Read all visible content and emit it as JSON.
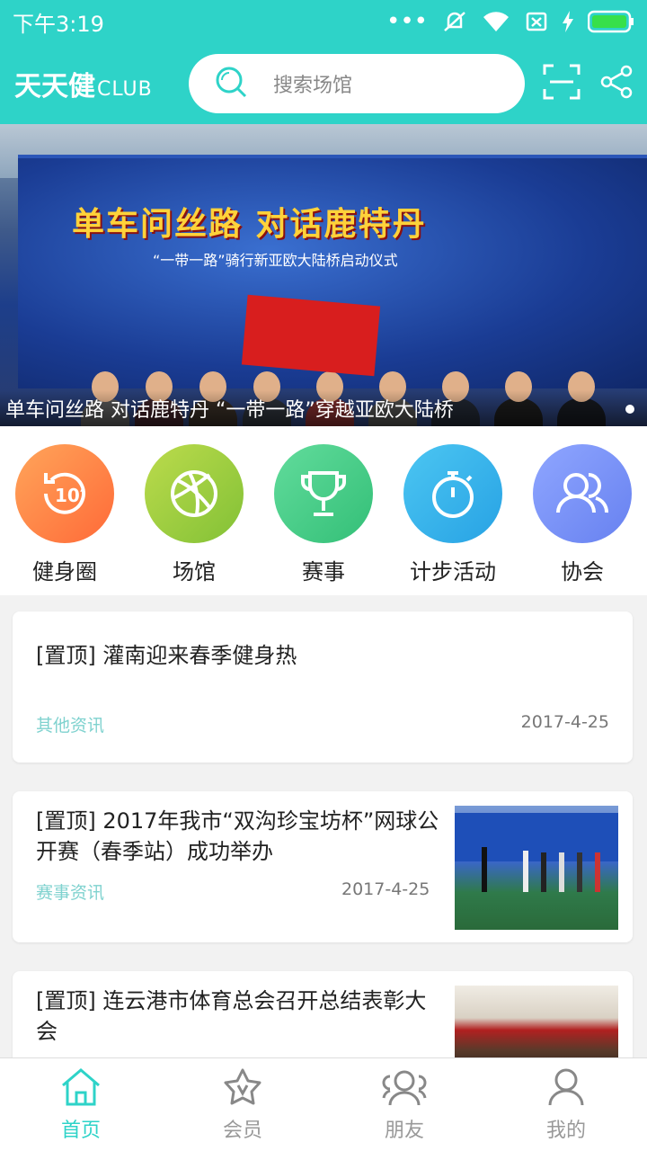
{
  "status_bar": {
    "time": "下午3:19"
  },
  "header": {
    "logo_main": "天天健",
    "logo_sub": "CLUB",
    "search_placeholder": "搜索场馆"
  },
  "banner": {
    "headline": "单车问丝路 对话鹿特丹",
    "subline": "“一带一路”骑行新亚欧大陆桥启动仪式",
    "caption": "单车问丝路 对话鹿特丹 “一带一路”穿越亚欧大陆桥"
  },
  "menu": [
    {
      "label": "健身圈",
      "icon": "fitness-circle-icon",
      "color_from": "#ff9b52",
      "color_to": "#ff6d3a"
    },
    {
      "label": "场馆",
      "icon": "basketball-icon",
      "color_from": "#b5d84a",
      "color_to": "#86c23a"
    },
    {
      "label": "赛事",
      "icon": "trophy-icon",
      "color_from": "#5fd99a",
      "color_to": "#36c27a"
    },
    {
      "label": "计步活动",
      "icon": "stopwatch-icon",
      "color_from": "#49c3f0",
      "color_to": "#2aa6e6"
    },
    {
      "label": "协会",
      "icon": "group-icon",
      "color_from": "#8aa2ff",
      "color_to": "#6a84f2"
    }
  ],
  "news": [
    {
      "title": "[置顶] 灌南迎来春季健身热",
      "category": "其他资讯",
      "date": "2017-4-25"
    },
    {
      "title": "[置顶] 2017年我市“双沟珍宝坊杯”网球公开赛（春季站）成功举办",
      "category": "赛事资讯",
      "date": "2017-4-25"
    },
    {
      "title": "[置顶] 连云港市体育总会召开总结表彰大会",
      "category": "",
      "date": ""
    }
  ],
  "tabs": [
    {
      "label": "首页",
      "icon": "home-icon",
      "active": true
    },
    {
      "label": "会员",
      "icon": "member-star-icon",
      "active": false
    },
    {
      "label": "朋友",
      "icon": "friends-icon",
      "active": false
    },
    {
      "label": "我的",
      "icon": "profile-icon",
      "active": false
    }
  ],
  "colors": {
    "accent": "#2ed3c8",
    "category_text": "#7fd2cf"
  }
}
